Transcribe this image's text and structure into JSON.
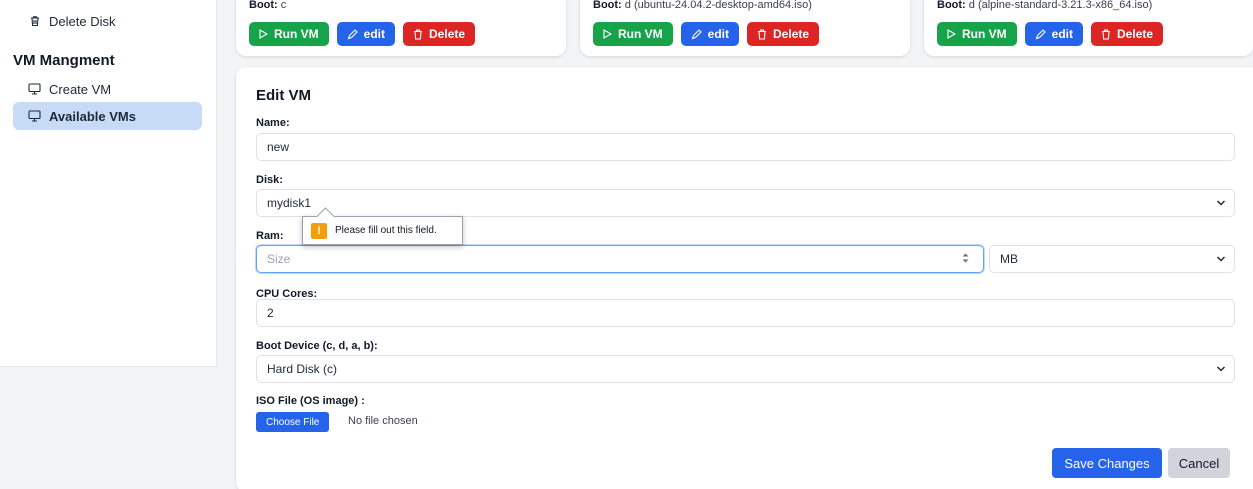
{
  "sidebar": {
    "delete_disk": "Delete Disk",
    "section_title": "VM Mangment",
    "create_vm": "Create VM",
    "available_vms": "Available VMs"
  },
  "vm_cards": [
    {
      "boot_label": "Boot:",
      "boot_value": "c",
      "run": "Run VM",
      "edit": "edit",
      "delete": "Delete"
    },
    {
      "boot_label": "Boot:",
      "boot_value": "d (ubuntu-24.04.2-desktop-amd64.iso)",
      "run": "Run VM",
      "edit": "edit",
      "delete": "Delete"
    },
    {
      "boot_label": "Boot:",
      "boot_value": "d (alpine-standard-3.21.3-x86_64.iso)",
      "run": "Run VM",
      "edit": "edit",
      "delete": "Delete"
    }
  ],
  "edit_form": {
    "title": "Edit VM",
    "name_label": "Name:",
    "name_value": "new",
    "disk_label": "Disk:",
    "disk_value": "mydisk1",
    "ram_label": "Ram:",
    "ram_placeholder": "Size",
    "ram_unit": "MB",
    "validation_message": "Please fill out this field.",
    "cpu_label": "CPU Cores:",
    "cpu_value": "2",
    "boot_label": "Boot Device (c, d, a, b):",
    "boot_value": "Hard Disk (c)",
    "iso_label": "ISO File (OS image) :",
    "choose_file": "Choose File",
    "no_file": "No file chosen",
    "save": "Save Changes",
    "cancel": "Cancel"
  },
  "colors": {
    "green": "#16a34a",
    "blue": "#2563eb",
    "red": "#dc2626",
    "active_bg": "#c7dbf7",
    "warning": "#f59e0b"
  }
}
